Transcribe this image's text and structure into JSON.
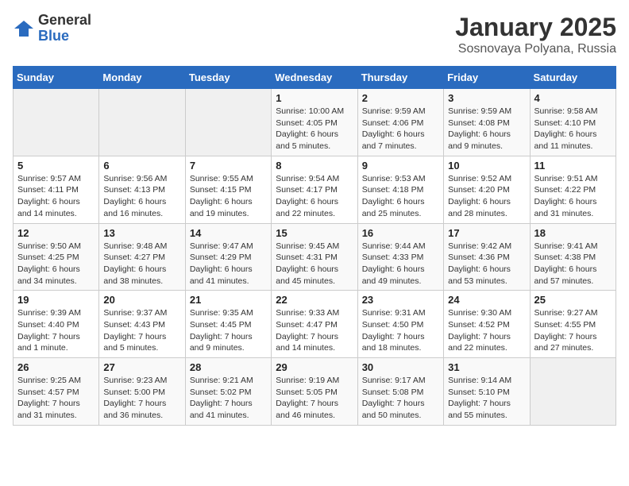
{
  "logo": {
    "general": "General",
    "blue": "Blue"
  },
  "title": "January 2025",
  "subtitle": "Sosnovaya Polyana, Russia",
  "days_of_week": [
    "Sunday",
    "Monday",
    "Tuesday",
    "Wednesday",
    "Thursday",
    "Friday",
    "Saturday"
  ],
  "weeks": [
    [
      {
        "day": "",
        "info": ""
      },
      {
        "day": "",
        "info": ""
      },
      {
        "day": "",
        "info": ""
      },
      {
        "day": "1",
        "info": "Sunrise: 10:00 AM\nSunset: 4:05 PM\nDaylight: 6 hours and 5 minutes."
      },
      {
        "day": "2",
        "info": "Sunrise: 9:59 AM\nSunset: 4:06 PM\nDaylight: 6 hours and 7 minutes."
      },
      {
        "day": "3",
        "info": "Sunrise: 9:59 AM\nSunset: 4:08 PM\nDaylight: 6 hours and 9 minutes."
      },
      {
        "day": "4",
        "info": "Sunrise: 9:58 AM\nSunset: 4:10 PM\nDaylight: 6 hours and 11 minutes."
      }
    ],
    [
      {
        "day": "5",
        "info": "Sunrise: 9:57 AM\nSunset: 4:11 PM\nDaylight: 6 hours and 14 minutes."
      },
      {
        "day": "6",
        "info": "Sunrise: 9:56 AM\nSunset: 4:13 PM\nDaylight: 6 hours and 16 minutes."
      },
      {
        "day": "7",
        "info": "Sunrise: 9:55 AM\nSunset: 4:15 PM\nDaylight: 6 hours and 19 minutes."
      },
      {
        "day": "8",
        "info": "Sunrise: 9:54 AM\nSunset: 4:17 PM\nDaylight: 6 hours and 22 minutes."
      },
      {
        "day": "9",
        "info": "Sunrise: 9:53 AM\nSunset: 4:18 PM\nDaylight: 6 hours and 25 minutes."
      },
      {
        "day": "10",
        "info": "Sunrise: 9:52 AM\nSunset: 4:20 PM\nDaylight: 6 hours and 28 minutes."
      },
      {
        "day": "11",
        "info": "Sunrise: 9:51 AM\nSunset: 4:22 PM\nDaylight: 6 hours and 31 minutes."
      }
    ],
    [
      {
        "day": "12",
        "info": "Sunrise: 9:50 AM\nSunset: 4:25 PM\nDaylight: 6 hours and 34 minutes."
      },
      {
        "day": "13",
        "info": "Sunrise: 9:48 AM\nSunset: 4:27 PM\nDaylight: 6 hours and 38 minutes."
      },
      {
        "day": "14",
        "info": "Sunrise: 9:47 AM\nSunset: 4:29 PM\nDaylight: 6 hours and 41 minutes."
      },
      {
        "day": "15",
        "info": "Sunrise: 9:45 AM\nSunset: 4:31 PM\nDaylight: 6 hours and 45 minutes."
      },
      {
        "day": "16",
        "info": "Sunrise: 9:44 AM\nSunset: 4:33 PM\nDaylight: 6 hours and 49 minutes."
      },
      {
        "day": "17",
        "info": "Sunrise: 9:42 AM\nSunset: 4:36 PM\nDaylight: 6 hours and 53 minutes."
      },
      {
        "day": "18",
        "info": "Sunrise: 9:41 AM\nSunset: 4:38 PM\nDaylight: 6 hours and 57 minutes."
      }
    ],
    [
      {
        "day": "19",
        "info": "Sunrise: 9:39 AM\nSunset: 4:40 PM\nDaylight: 7 hours and 1 minute."
      },
      {
        "day": "20",
        "info": "Sunrise: 9:37 AM\nSunset: 4:43 PM\nDaylight: 7 hours and 5 minutes."
      },
      {
        "day": "21",
        "info": "Sunrise: 9:35 AM\nSunset: 4:45 PM\nDaylight: 7 hours and 9 minutes."
      },
      {
        "day": "22",
        "info": "Sunrise: 9:33 AM\nSunset: 4:47 PM\nDaylight: 7 hours and 14 minutes."
      },
      {
        "day": "23",
        "info": "Sunrise: 9:31 AM\nSunset: 4:50 PM\nDaylight: 7 hours and 18 minutes."
      },
      {
        "day": "24",
        "info": "Sunrise: 9:30 AM\nSunset: 4:52 PM\nDaylight: 7 hours and 22 minutes."
      },
      {
        "day": "25",
        "info": "Sunrise: 9:27 AM\nSunset: 4:55 PM\nDaylight: 7 hours and 27 minutes."
      }
    ],
    [
      {
        "day": "26",
        "info": "Sunrise: 9:25 AM\nSunset: 4:57 PM\nDaylight: 7 hours and 31 minutes."
      },
      {
        "day": "27",
        "info": "Sunrise: 9:23 AM\nSunset: 5:00 PM\nDaylight: 7 hours and 36 minutes."
      },
      {
        "day": "28",
        "info": "Sunrise: 9:21 AM\nSunset: 5:02 PM\nDaylight: 7 hours and 41 minutes."
      },
      {
        "day": "29",
        "info": "Sunrise: 9:19 AM\nSunset: 5:05 PM\nDaylight: 7 hours and 46 minutes."
      },
      {
        "day": "30",
        "info": "Sunrise: 9:17 AM\nSunset: 5:08 PM\nDaylight: 7 hours and 50 minutes."
      },
      {
        "day": "31",
        "info": "Sunrise: 9:14 AM\nSunset: 5:10 PM\nDaylight: 7 hours and 55 minutes."
      },
      {
        "day": "",
        "info": ""
      }
    ]
  ]
}
